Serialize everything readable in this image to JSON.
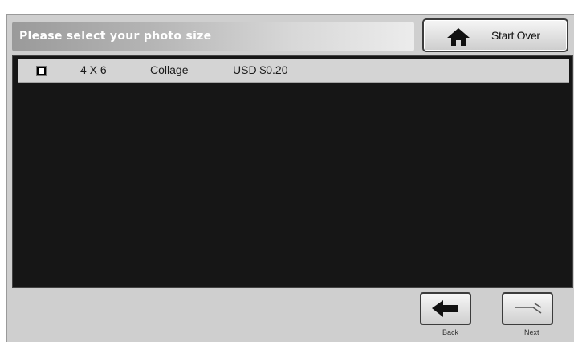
{
  "header": {
    "title": "Please select your photo size",
    "start_over_label": "Start Over",
    "start_over_icon": "home-icon"
  },
  "list": {
    "rows": [
      {
        "size": "4 X 6",
        "type": "Collage",
        "price": "USD $0.20",
        "checked": false
      }
    ]
  },
  "footer": {
    "back_label": "Back",
    "back_icon": "arrow-left-icon",
    "next_label": "Next",
    "next_icon": "arrow-right-icon"
  },
  "colors": {
    "panel_background": "#161616",
    "row_background": "#d4d4d4",
    "chrome_background": "#cfcfcf"
  }
}
